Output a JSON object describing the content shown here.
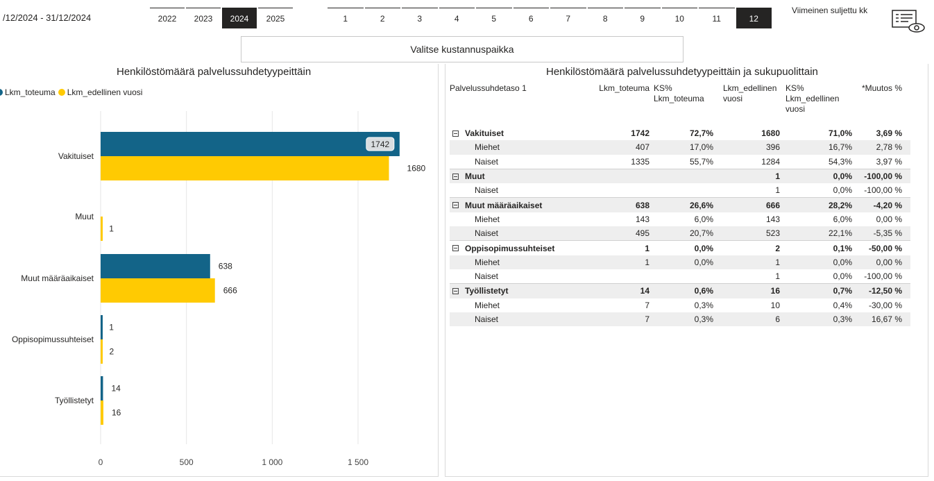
{
  "header": {
    "date_range": "/12/2024 - 31/12/2024",
    "years": [
      {
        "label": "2022",
        "selected": false
      },
      {
        "label": "2023",
        "selected": false
      },
      {
        "label": "2024",
        "selected": true
      },
      {
        "label": "2025",
        "selected": false
      }
    ],
    "months": [
      {
        "label": "1",
        "selected": false
      },
      {
        "label": "2",
        "selected": false
      },
      {
        "label": "3",
        "selected": false
      },
      {
        "label": "4",
        "selected": false
      },
      {
        "label": "5",
        "selected": false
      },
      {
        "label": "6",
        "selected": false
      },
      {
        "label": "7",
        "selected": false
      },
      {
        "label": "8",
        "selected": false
      },
      {
        "label": "9",
        "selected": false
      },
      {
        "label": "10",
        "selected": false
      },
      {
        "label": "11",
        "selected": false
      },
      {
        "label": "12",
        "selected": true
      }
    ],
    "last_closed_label": "Viimeinen suljettu kk",
    "report_icon": "report-view-icon",
    "cost_center_button": "Valitse kustannuspaikka"
  },
  "colors": {
    "series_current": "#136488",
    "series_previous": "#FFCA02",
    "selected_slicer": "#252423"
  },
  "chart_data": {
    "type": "bar",
    "orientation": "horizontal",
    "title": "Henkilöstömäärä palvelussuhdetyypeittäin",
    "categories": [
      "Vakituiset",
      "Muut",
      "Muut määräaikaiset",
      "Oppisopimussuhteiset",
      "Työllistetyt"
    ],
    "series": [
      {
        "name": "Lkm_toteuma",
        "values": [
          1742,
          null,
          638,
          1,
          14
        ]
      },
      {
        "name": "Lkm_edellinen vuosi",
        "values": [
          1680,
          1,
          666,
          2,
          16
        ]
      }
    ],
    "xlim": [
      0,
      2000
    ],
    "xticks": [
      "0",
      "500",
      "1 000",
      "1 500"
    ],
    "xtick_values": [
      0,
      500,
      1000,
      1500
    ],
    "legend_labels": {
      "current": "Lkm_toteuma",
      "previous": "Lkm_edellinen vuosi"
    },
    "legend_position": "top-left",
    "grid": true
  },
  "table": {
    "title": "Henkilöstömäärä palvelussuhdetyypeittäin ja sukupuolittain",
    "headers": [
      "Palvelussuhdetaso 1",
      "Lkm_toteuma",
      "KS% Lkm_toteuma",
      "Lkm_edellinen vuosi",
      "KS% Lkm_edellinen vuosi",
      "*Muutos %"
    ],
    "rows": [
      {
        "type": "group",
        "cells": [
          "Vakituiset",
          "1742",
          "72,7%",
          "1680",
          "71,0%",
          "3,69 %"
        ]
      },
      {
        "type": "child",
        "cells": [
          "Miehet",
          "407",
          "17,0%",
          "396",
          "16,7%",
          "2,78 %"
        ]
      },
      {
        "type": "child",
        "cells": [
          "Naiset",
          "1335",
          "55,7%",
          "1284",
          "54,3%",
          "3,97 %"
        ]
      },
      {
        "type": "group",
        "cells": [
          "Muut",
          "",
          "",
          "1",
          "0,0%",
          "-100,00 %"
        ]
      },
      {
        "type": "child",
        "cells": [
          "Naiset",
          "",
          "",
          "1",
          "0,0%",
          "-100,00 %"
        ]
      },
      {
        "type": "group",
        "cells": [
          "Muut määräaikaiset",
          "638",
          "26,6%",
          "666",
          "28,2%",
          "-4,20 %"
        ]
      },
      {
        "type": "child",
        "cells": [
          "Miehet",
          "143",
          "6,0%",
          "143",
          "6,0%",
          "0,00 %"
        ]
      },
      {
        "type": "child",
        "cells": [
          "Naiset",
          "495",
          "20,7%",
          "523",
          "22,1%",
          "-5,35 %"
        ]
      },
      {
        "type": "group",
        "cells": [
          "Oppisopimussuhteiset",
          "1",
          "0,0%",
          "2",
          "0,1%",
          "-50,00 %"
        ]
      },
      {
        "type": "child",
        "cells": [
          "Miehet",
          "1",
          "0,0%",
          "1",
          "0,0%",
          "0,00 %"
        ]
      },
      {
        "type": "child",
        "cells": [
          "Naiset",
          "",
          "",
          "1",
          "0,0%",
          "-100,00 %"
        ]
      },
      {
        "type": "group",
        "cells": [
          "Työllistetyt",
          "14",
          "0,6%",
          "16",
          "0,7%",
          "-12,50 %"
        ]
      },
      {
        "type": "child",
        "cells": [
          "Miehet",
          "7",
          "0,3%",
          "10",
          "0,4%",
          "-30,00 %"
        ]
      },
      {
        "type": "child",
        "cells": [
          "Naiset",
          "7",
          "0,3%",
          "6",
          "0,3%",
          "16,67 %"
        ]
      }
    ]
  }
}
